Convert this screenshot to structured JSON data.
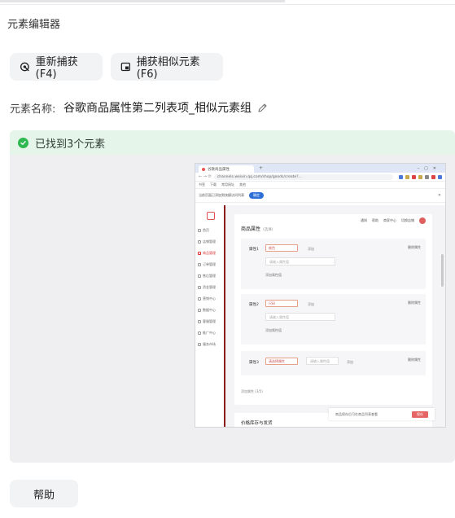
{
  "header": {
    "title": "元素编辑器"
  },
  "toolbar": {
    "recapture_label": "重新捕获(F4)",
    "capture_similar_label": "捕获相似元素(F6)"
  },
  "element": {
    "name_label": "元素名称:",
    "name_value": "谷歌商品属性第二列表项_相似元素组"
  },
  "result": {
    "found_text": "已找到3个元素"
  },
  "preview": {
    "tab_title": "谷歌商品属性",
    "url": "channels.weixin.qq.com/shop/goods/create?...",
    "bookmarks": [
      "书签",
      "下载",
      "常用网址",
      "其他"
    ],
    "notice_text": "当前页面已添加到快捷访问列表",
    "notice_button": "确定",
    "sidebar_items": [
      "首页",
      "店铺管理",
      "商品管理",
      "订单管理",
      "售后管理",
      "资金管理",
      "营销中心",
      "数据中心",
      "客服管理",
      "推广中心",
      "服务市场"
    ],
    "active_index": 2,
    "toolbar_items": [
      "通知",
      "帮助",
      "商家中心",
      "切换店铺"
    ],
    "card_title": "商品属性",
    "card_subtitle": "(选填)",
    "specs": [
      {
        "label": "属性1",
        "select": "颜色",
        "checkbox": "添加",
        "input": "请输入属性值",
        "add": "添加属性值",
        "delete": "删除属性"
      },
      {
        "label": "属性2",
        "select": "尺码",
        "checkbox": "添加",
        "input": "请输入属性值",
        "add": "添加属性值",
        "delete": "删除属性"
      },
      {
        "label": "属性3",
        "select": "请选择属性",
        "checkbox": "添加",
        "input": "请输入属性值",
        "add": "",
        "delete": "删除属性"
      }
    ],
    "add_more": "添加属性 (3/5)",
    "bottom_title": "价格库存与发货",
    "float_text": "商品保存后可在商品列表查看",
    "float_button": "保存"
  },
  "footer": {
    "help_label": "帮助"
  }
}
